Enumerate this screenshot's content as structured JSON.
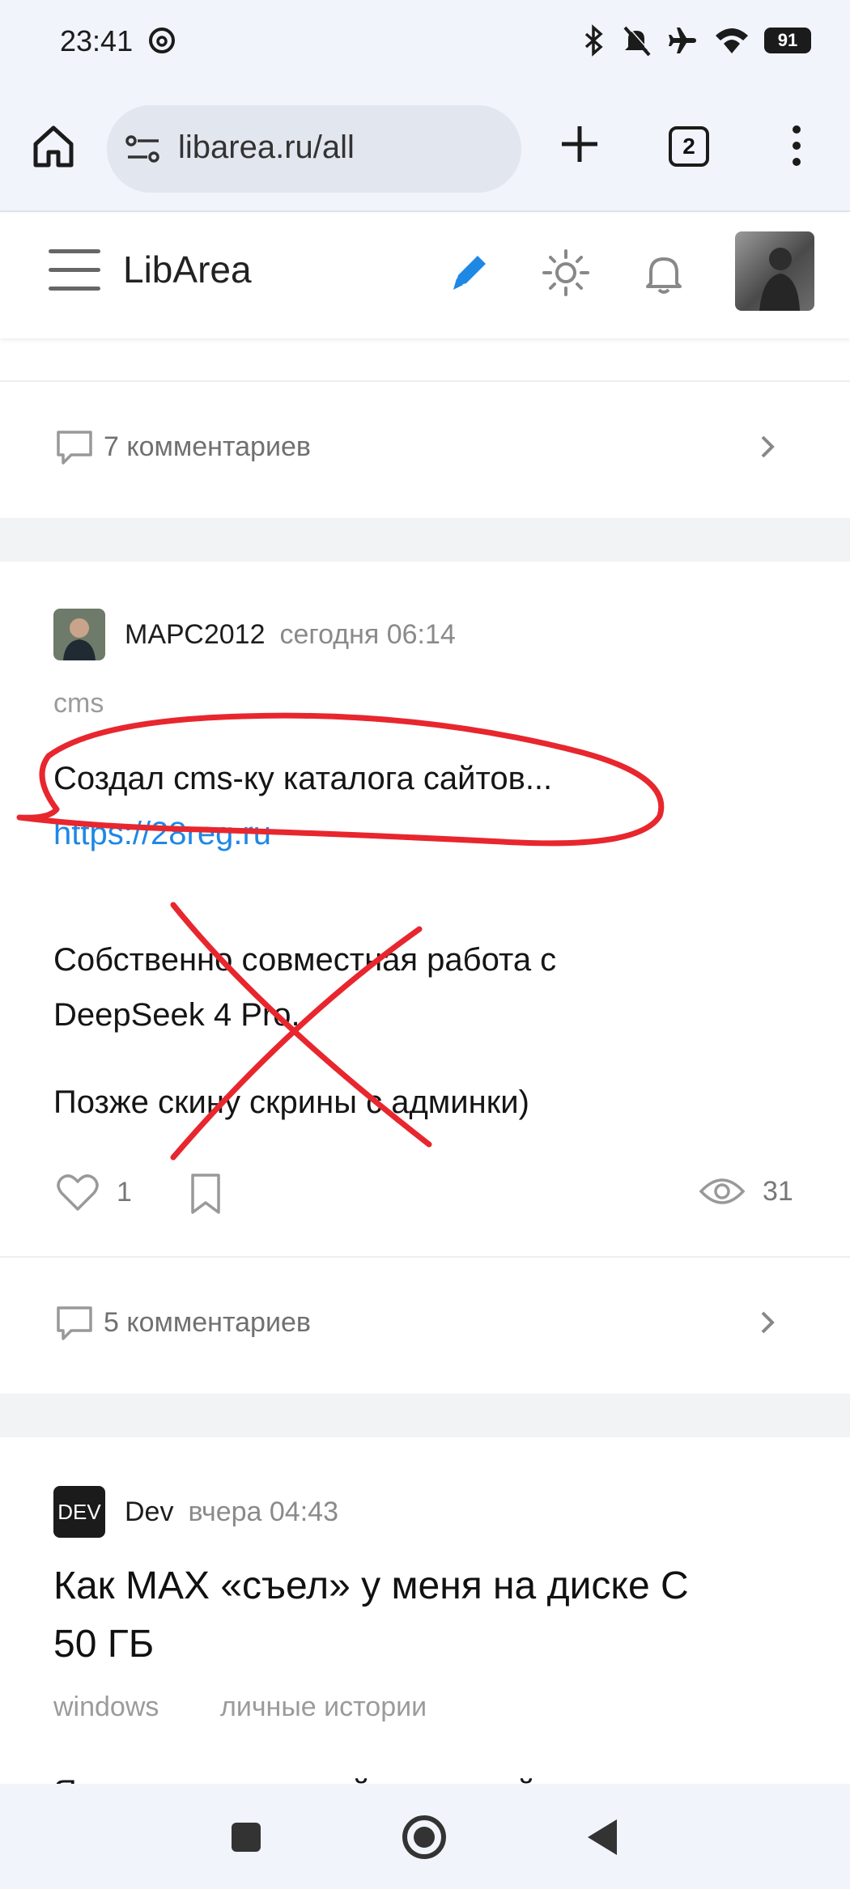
{
  "status": {
    "time": "23:41",
    "battery": "91"
  },
  "browser": {
    "url": "libarea.ru/all",
    "tab_count": "2"
  },
  "site": {
    "name": "LibArea"
  },
  "feed": {
    "prev_post": {
      "comments": "7 комментариев"
    },
    "post1": {
      "author": "МАРС2012",
      "time": "сегодня 06:14",
      "tag": "cms",
      "line1": "Создал cms-ку каталога сайтов...",
      "link": "https://28reg.ru",
      "para2_line1": "Собственно совместная работа с",
      "para2_line2": "DeepSeek 4 Pro.",
      "para3": "Позже скину скрины с админки)",
      "likes": "1",
      "views": "31",
      "comments": "5 комментариев"
    },
    "post2": {
      "author_badge": "DEV",
      "author": "Dev",
      "time": "вчера 04:43",
      "title_line1": "Как MAX «съел» у меня на диске С",
      "title_line2": "50 ГБ",
      "tags": [
        "windows",
        "личные истории"
      ],
      "text_start": "Я столкнулся с такой ситуацией:"
    }
  },
  "colors": {
    "accent": "#1e88e5",
    "annotation": "#e8262e"
  }
}
